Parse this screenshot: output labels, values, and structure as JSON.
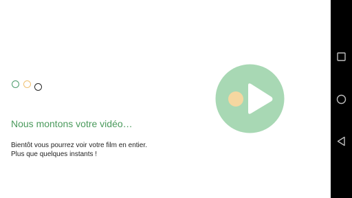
{
  "loading": {
    "title": "Nous montons votre vidéo…",
    "line1": "Bientôt vous pourrez voir votre film en entier.",
    "line2": "Plus que quelques instants !"
  },
  "colors": {
    "accent_green": "#4a9a5c",
    "circle_light_green": "#a8d8b4",
    "dot_orange": "#f5d7a0",
    "nav_background": "#000000",
    "nav_icon": "#bdbdbd"
  },
  "icons": {
    "recents": "square-icon",
    "home": "circle-icon",
    "back": "triangle-back-icon",
    "play": "play-icon"
  }
}
